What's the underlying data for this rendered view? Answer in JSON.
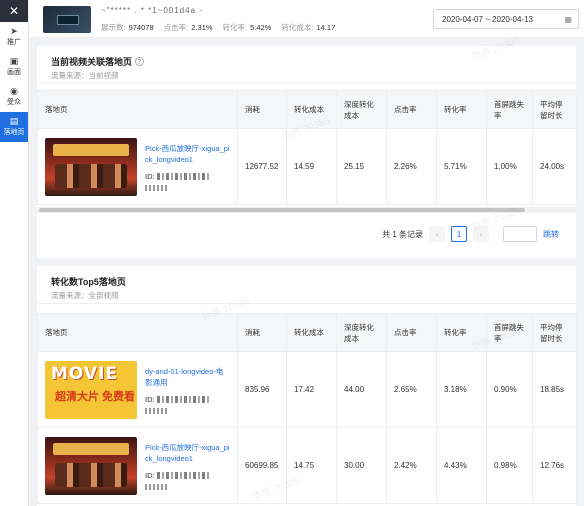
{
  "rail": {
    "items": [
      {
        "label": "推广",
        "icon": "send-icon"
      },
      {
        "label": "画面",
        "icon": "screen-icon"
      },
      {
        "label": "受众",
        "icon": "audience-icon"
      },
      {
        "label": "落地页",
        "icon": "landing-page-icon"
      }
    ],
    "active_index": 3
  },
  "header": {
    "video_title": "~\"***** . * *1~001d4a  -",
    "stats": [
      {
        "label": "展示数:",
        "value": "974078"
      },
      {
        "label": "点击率:",
        "value": "2.31%"
      },
      {
        "label": "转化率:",
        "value": "5.42%"
      },
      {
        "label": "转化成本:",
        "value": "14.17"
      }
    ],
    "date_range": "2020-04-07 ~ 2020-04-13"
  },
  "card1": {
    "title": "当前视频关联落地页",
    "source": "流量来源：当前视频",
    "columns": [
      "落地页",
      "消耗",
      "转化成本",
      "深度转化成本",
      "点击率",
      "转化率",
      "首屏跳失率",
      "平均停留时长"
    ],
    "rows": [
      {
        "name": "Pick-西瓜放映厅-xigua_pick_longvideo1",
        "id_prefix": "ID:",
        "cost": "12677.52",
        "conv_cost": "14.59",
        "deep_conv_cost": "25.15",
        "ctr": "2.26%",
        "cvr": "5.71%",
        "bounce": "1.00%",
        "stay": "24.00s"
      }
    ],
    "pagination": {
      "total": "共 1 条记录",
      "current": "1",
      "jump": "跳转"
    }
  },
  "card2": {
    "title": "转化数Top5落地页",
    "source": "流量来源：全部视频",
    "columns": [
      "落地页",
      "消耗",
      "转化成本",
      "深度转化成本",
      "点击率",
      "转化率",
      "首屏跳失率",
      "平均停留时长"
    ],
    "rows": [
      {
        "name": "dy-and-01-longvideo-电影通用",
        "id_prefix": "ID:",
        "thumb_word": "MOVIE",
        "thumb_cn": "超清大片 免费看",
        "cost": "835.96",
        "conv_cost": "17.42",
        "deep_conv_cost": "44.00",
        "ctr": "2.65%",
        "cvr": "3.18%",
        "bounce": "0.90%",
        "stay": "18.85s"
      },
      {
        "name": "Pick-西瓜放映厅-xigua_pick_longvideo1",
        "id_prefix": "ID:",
        "cost": "60699.85",
        "conv_cost": "14.75",
        "deep_conv_cost": "30.00",
        "ctr": "2.42%",
        "cvr": "4.43%",
        "bounce": "0.98%",
        "stay": "12.76s"
      }
    ]
  },
  "watermark": "协商 20385",
  "colors": {
    "accent": "#1f6fe0",
    "rail_dark": "#2b2f3a",
    "header_bg": "#f5f6f7"
  }
}
